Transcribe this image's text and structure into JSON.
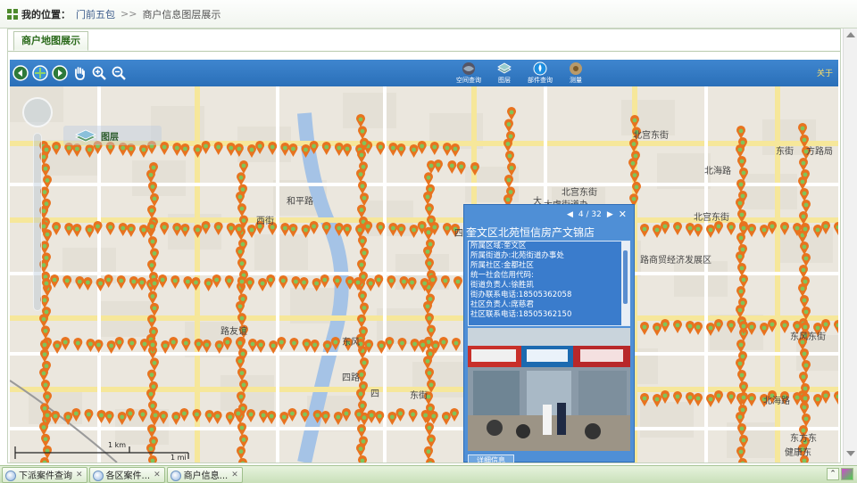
{
  "breadcrumb": {
    "label": "我的位置：",
    "items": [
      "门前五包",
      "商户信息图层展示"
    ],
    "separator": ">>"
  },
  "tab": {
    "label": "商户地图展示"
  },
  "toolbar": {
    "tools": [
      {
        "icon": "spatial-query-icon",
        "label": "空间查询"
      },
      {
        "icon": "layers-icon",
        "label": "图层"
      },
      {
        "icon": "component-query-icon",
        "label": "部件查询"
      },
      {
        "icon": "measure-icon",
        "label": "测量"
      }
    ],
    "about": "关于"
  },
  "layer_button": {
    "label": "图层"
  },
  "map_labels": [
    "北宫东街",
    "北海路",
    "大虞街道办",
    "北宫东街",
    "北宫东街",
    "路商贸经济发展区",
    "东风东街",
    "北海路",
    "东方东",
    "健康东",
    "西街",
    "四路",
    "东街",
    "和平路",
    "四街",
    "大",
    "路友谊",
    "四",
    "东风",
    "方路局",
    "东街"
  ],
  "popup": {
    "pager": "4 / 32",
    "title": "奎文区北苑恒信房产文锦店",
    "lines": [
      "所属区域:奎文区",
      "所属街道办:北苑街道办事处",
      "所属社区:金都社区",
      "统一社会信用代码:",
      "街道负责人:徐胜凯",
      "街办联系电话:18505362058",
      "社区负责人:席慈君",
      "社区联系电话:18505362150"
    ],
    "more_button": "详细信息"
  },
  "scale": {
    "km": "1 km",
    "mi": "1 mi"
  },
  "taskbar": {
    "tasks": [
      "下派案件查询",
      "各区案件...",
      "商户信息..."
    ]
  }
}
